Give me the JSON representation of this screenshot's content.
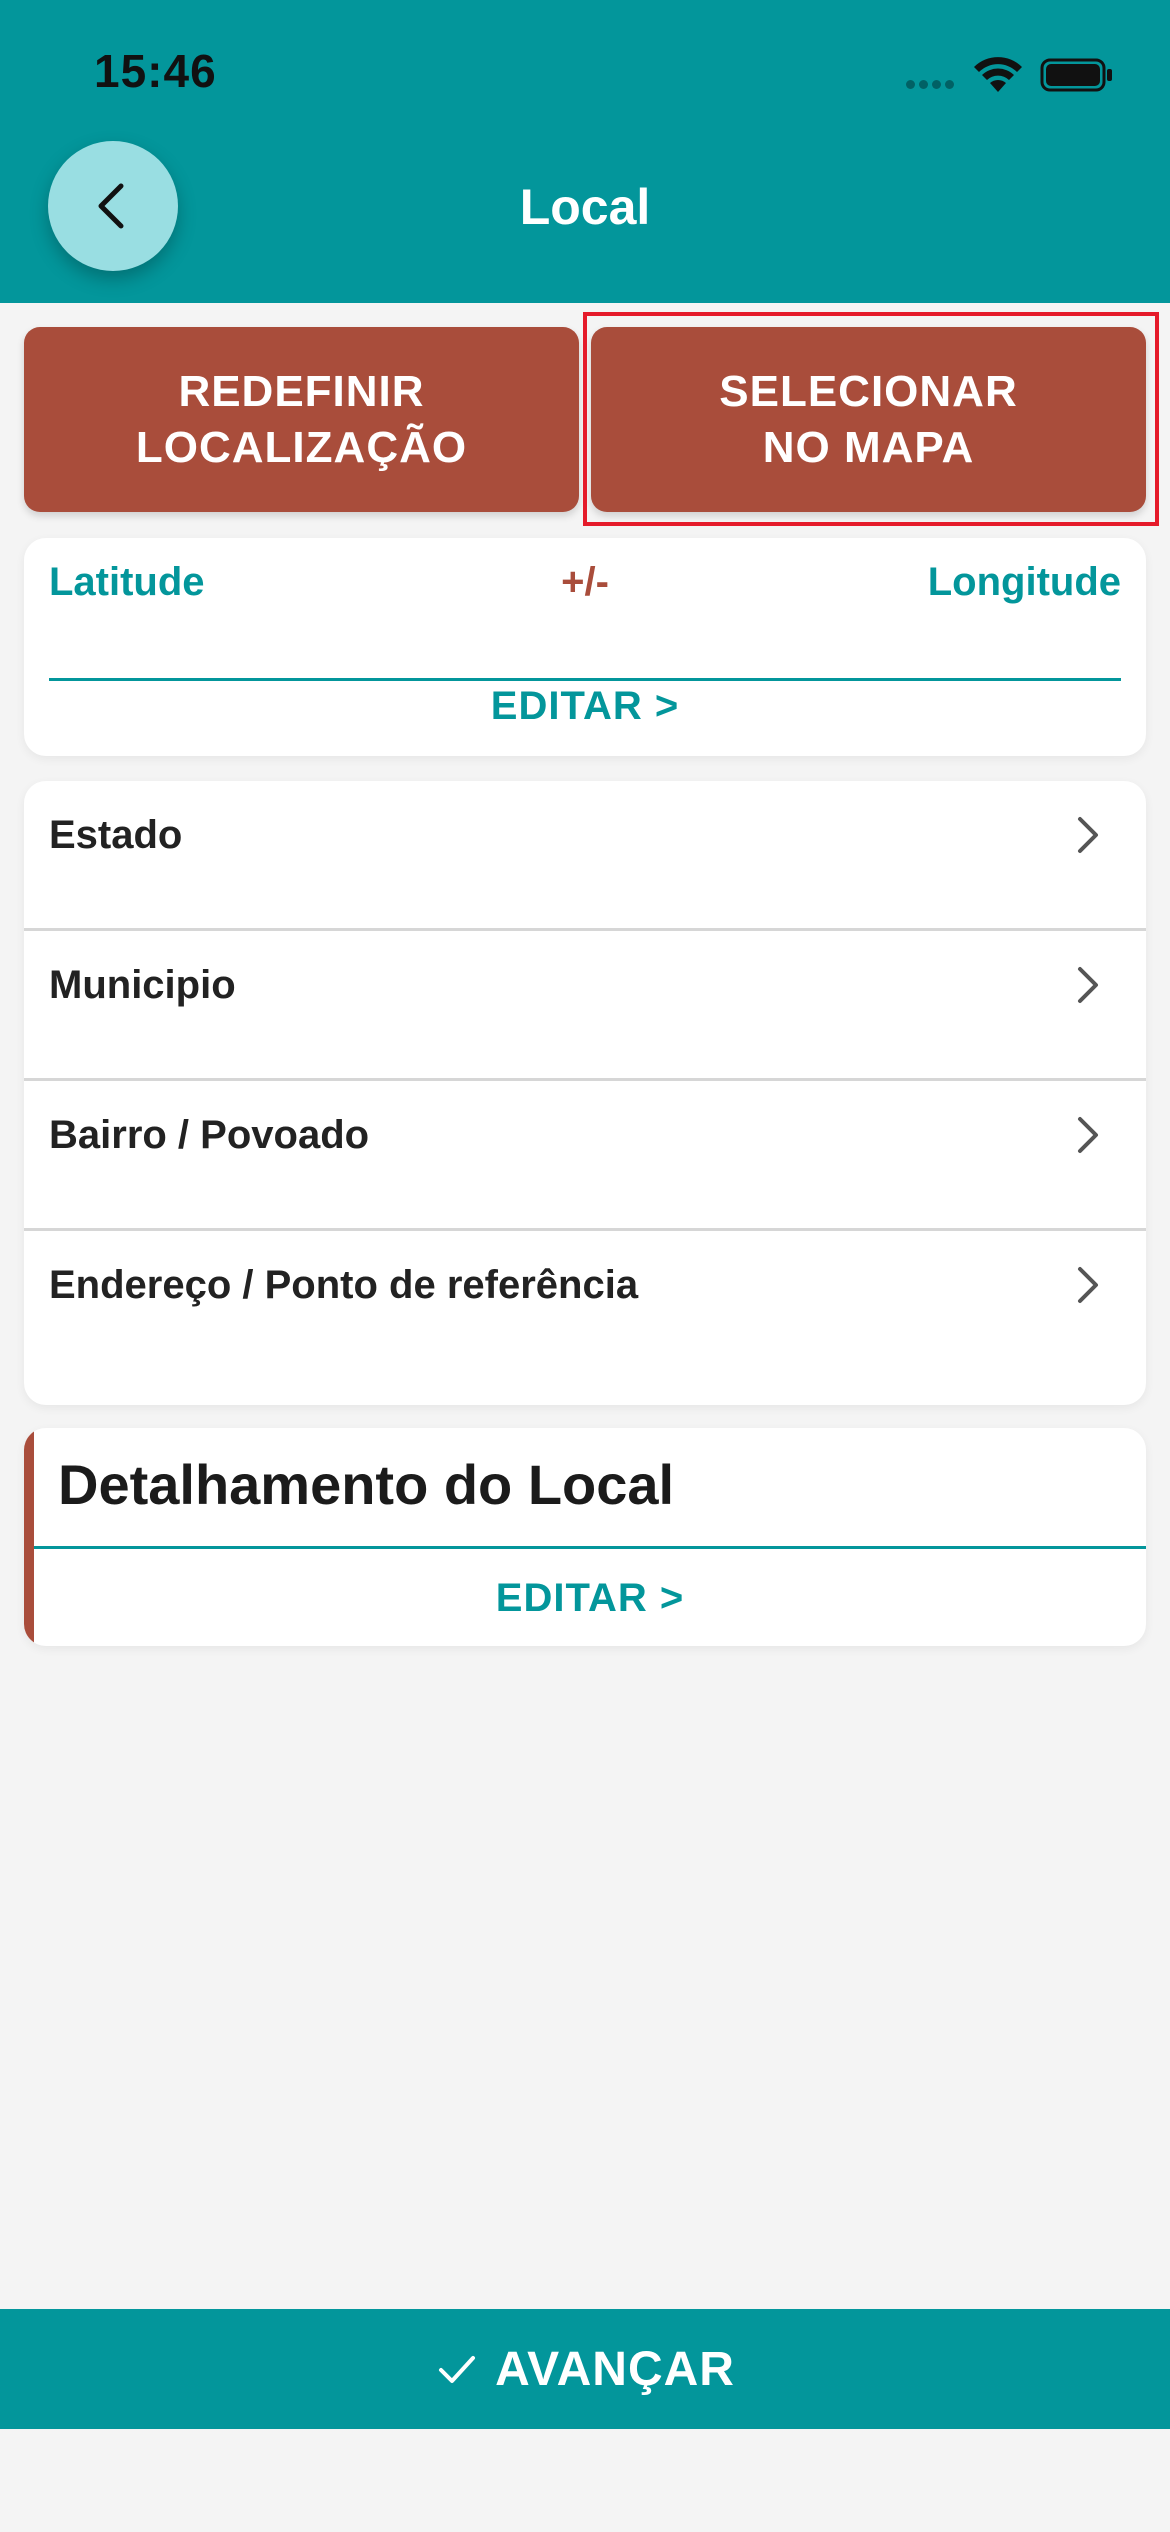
{
  "status_bar": {
    "time": "15:46"
  },
  "header": {
    "title": "Local",
    "back_icon": "chevron-left-icon"
  },
  "actions": {
    "reset_label": "REDEFINIR\nLOCALIZAÇÃO",
    "map_label": "SELECIONAR\nNO MAPA"
  },
  "coordinates": {
    "latitude_label": "Latitude",
    "precision_label": "+/-",
    "longitude_label": "Longitude",
    "edit_label": "EDITAR >"
  },
  "address_fields": [
    {
      "label": "Estado"
    },
    {
      "label": "Municipio"
    },
    {
      "label": "Bairro / Povoado"
    },
    {
      "label": "Endereço / Ponto de referência"
    }
  ],
  "details": {
    "title": "Detalhamento do Local",
    "edit_label": "EDITAR >"
  },
  "footer": {
    "advance_label": "AVANÇAR",
    "icon": "check-icon"
  },
  "colors": {
    "primary": "#03969b",
    "accent": "#a94d3b",
    "highlight": "#e51b2a"
  }
}
